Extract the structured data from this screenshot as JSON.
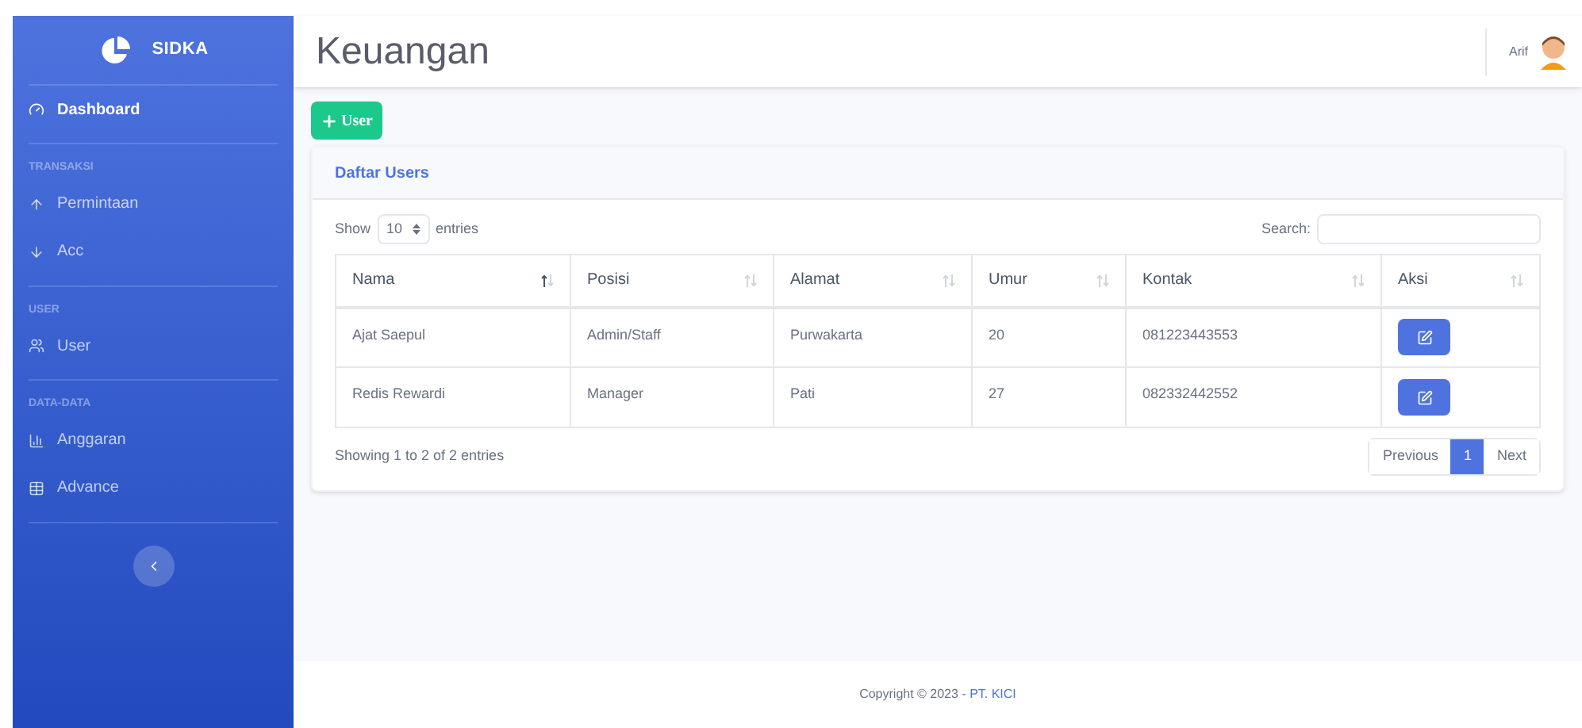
{
  "brand": "SIDKA",
  "sidebar": {
    "sections": [
      {
        "items": [
          {
            "label": "Dashboard",
            "selected": true
          }
        ]
      },
      {
        "heading": "TRANSAKSI",
        "items": [
          {
            "label": "Permintaan",
            "selected": false
          },
          {
            "label": "Acc",
            "selected": false
          }
        ]
      },
      {
        "heading": "USER",
        "items": [
          {
            "label": "User",
            "selected": false
          }
        ]
      },
      {
        "heading": "DATA-DATA",
        "items": [
          {
            "label": "Anggaran",
            "selected": false
          },
          {
            "label": "Advance",
            "selected": false
          }
        ]
      }
    ]
  },
  "page_title": "Keuangan",
  "user": {
    "name": "Arif"
  },
  "add_button": "User",
  "card": {
    "title": "Daftar Users",
    "show_label": "Show",
    "page_size": "10",
    "entries_label": "entries",
    "search_label": "Search:",
    "columns": [
      {
        "label": "Nama",
        "sorted": true
      },
      {
        "label": "Posisi",
        "sorted": false
      },
      {
        "label": "Alamat",
        "sorted": false
      },
      {
        "label": "Umur",
        "sorted": false
      },
      {
        "label": "Kontak",
        "sorted": false
      },
      {
        "label": "Aksi",
        "sorted": false
      }
    ],
    "rows": [
      [
        "Ajat Saepul",
        "Admin/Staff",
        "Purwakarta",
        "20",
        "081223443553"
      ],
      [
        "Redis Rewardi",
        "Manager",
        "Pati",
        "27",
        "082332442552"
      ]
    ],
    "info": "Showing 1 to 2 of 2 entries",
    "pagination": [
      {
        "label": "Previous",
        "selected": false
      },
      {
        "label": "1",
        "selected": true
      },
      {
        "label": "Next",
        "selected": false
      }
    ]
  },
  "footer": {
    "text": "Copyright © 2023 - ",
    "link": "PT. KICI"
  }
}
